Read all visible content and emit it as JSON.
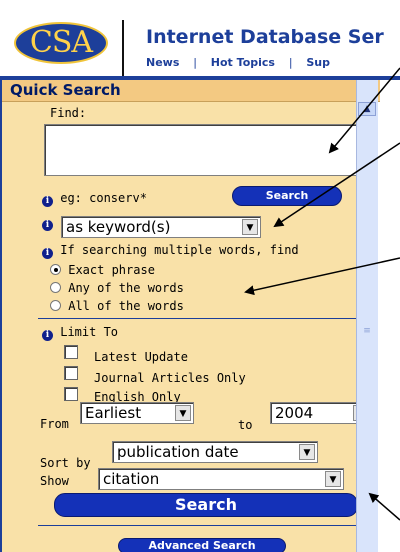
{
  "header": {
    "logo_text": "CSA",
    "title": "Internet Database Ser",
    "nav": [
      "News",
      "Hot Topics",
      "Sup"
    ]
  },
  "panel": {
    "title": "Quick Search",
    "find_label": "Find:",
    "find_value": "",
    "example_text": "eg: conserv*",
    "search_small_label": "Search",
    "field_select": "as keyword(s)",
    "multi_words_text": "If searching multiple words, find",
    "radios": [
      {
        "label": "Exact phrase",
        "checked": true
      },
      {
        "label": "Any of the words",
        "checked": false
      },
      {
        "label": "All of the words",
        "checked": false
      }
    ],
    "limit_to_label": "Limit To",
    "limits": [
      {
        "label": "Latest Update"
      },
      {
        "label": "Journal Articles Only"
      },
      {
        "label": "English Only"
      }
    ],
    "from_label": "From",
    "from_value": "Earliest",
    "to_label": "to",
    "to_value": "2004",
    "sort_label": "Sort by",
    "sort_value": "publication date",
    "show_label": "Show",
    "show_value": "citation",
    "search_big_label": "Search",
    "advanced_label": "Advanced Search"
  },
  "colors": {
    "brand_blue": "#1d3f9a",
    "panel_bg": "#f9e1a8",
    "button_blue": "#1431b8"
  }
}
